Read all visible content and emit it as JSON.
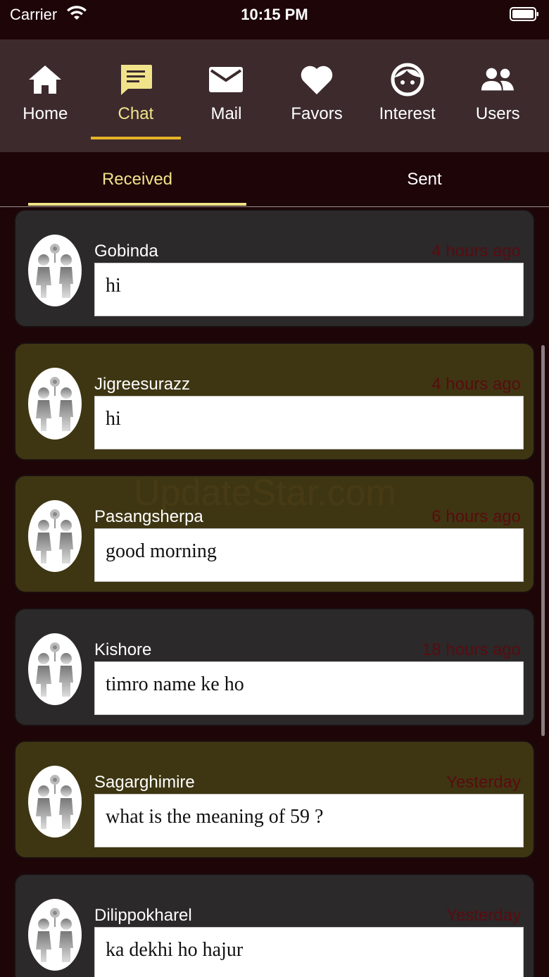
{
  "status_bar": {
    "carrier": "Carrier",
    "time": "10:15 PM"
  },
  "nav": [
    {
      "label": "Home",
      "icon": "home-icon"
    },
    {
      "label": "Chat",
      "icon": "chat-icon",
      "active": true
    },
    {
      "label": "Mail",
      "icon": "mail-icon"
    },
    {
      "label": "Favors",
      "icon": "heart-icon"
    },
    {
      "label": "Interest",
      "icon": "face-icon"
    },
    {
      "label": "Users",
      "icon": "users-icon"
    }
  ],
  "tabs": {
    "received": "Received",
    "sent": "Sent",
    "selected": "Received"
  },
  "messages": [
    {
      "sender": "Gobinda",
      "time": "4 hours ago",
      "text": "hi",
      "highlighted": false
    },
    {
      "sender": "Jigreesurazz",
      "time": "4 hours ago",
      "text": "hi",
      "highlighted": true
    },
    {
      "sender": "Pasangsherpa",
      "time": "6 hours ago",
      "text": "good morning",
      "highlighted": true
    },
    {
      "sender": "Kishore",
      "time": "18 hours ago",
      "text": "timro name ke ho",
      "highlighted": false
    },
    {
      "sender": "Sagarghimire",
      "time": "Yesterday",
      "text": "what is the meaning of 59 ?",
      "highlighted": true
    },
    {
      "sender": "Dilippokharel",
      "time": "Yesterday",
      "text": "ka dekhi ho hajur",
      "highlighted": false
    }
  ],
  "watermark": "UpdateStar.com",
  "colors": {
    "accent": "#f0e38a",
    "indicator": "#e6b326",
    "nav_bg": "#3c2a2d",
    "page_bg": "#1e0508",
    "highlight_card": "#3e3612",
    "card": "#2b292a"
  }
}
